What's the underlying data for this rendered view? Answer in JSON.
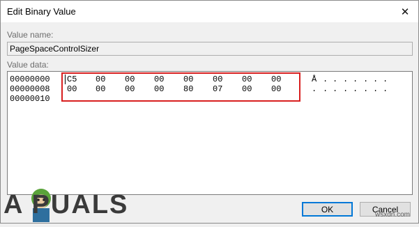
{
  "window": {
    "title": "Edit Binary Value",
    "close_glyph": "✕"
  },
  "value_name": {
    "label": "Value name:",
    "value": "PageSpaceControlSizer"
  },
  "value_data": {
    "label": "Value data:",
    "rows": [
      {
        "offset": "00000000",
        "bytes": [
          "C5",
          "00",
          "00",
          "00",
          "00",
          "00",
          "00",
          "00"
        ],
        "ascii": [
          "Å",
          ".",
          ".",
          ".",
          ".",
          ".",
          ".",
          "."
        ]
      },
      {
        "offset": "00000008",
        "bytes": [
          "00",
          "00",
          "00",
          "00",
          "80",
          "07",
          "00",
          "00"
        ],
        "ascii": [
          ".",
          ".",
          ".",
          ".",
          ".",
          ".",
          ".",
          "."
        ]
      },
      {
        "offset": "00000010",
        "bytes": [],
        "ascii": []
      }
    ]
  },
  "buttons": {
    "ok": "OK",
    "cancel": "Cancel"
  },
  "watermark": {
    "logo_text": "A   PUALS",
    "site": "wsxdn.com"
  },
  "colors": {
    "highlight": "#d81f1f",
    "focus": "#0078d7"
  }
}
